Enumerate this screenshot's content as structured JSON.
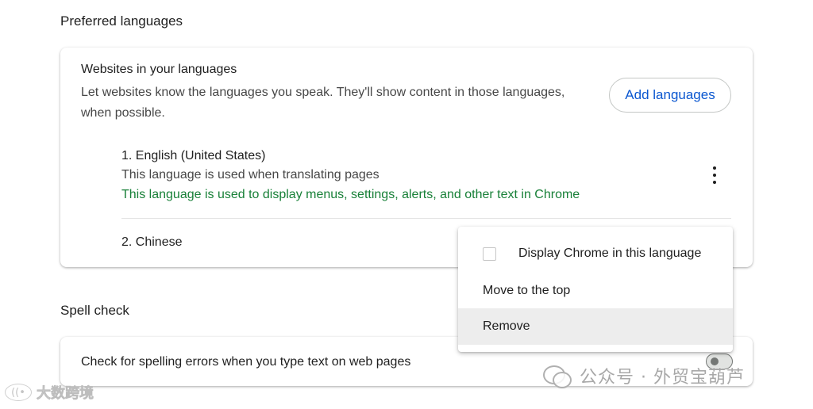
{
  "preferred_languages": {
    "section_title": "Preferred languages",
    "websites_title": "Websites in your languages",
    "websites_desc": "Let websites know the languages you speak. They'll show content in those languages, when possible.",
    "add_button_label": "Add languages",
    "languages": [
      {
        "name": "1. English (United States)",
        "note1": "This language is used when translating pages",
        "note2": "This language is used to display menus, settings, alerts, and other text in Chrome"
      },
      {
        "name": "2. Chinese"
      }
    ]
  },
  "context_menu": {
    "display_chrome_label": "Display Chrome in this language",
    "display_chrome_checked": false,
    "move_top_label": "Move to the top",
    "remove_label": "Remove"
  },
  "spell_check": {
    "section_title": "Spell check",
    "check_label": "Check for spelling errors when you type text on web pages",
    "enabled": false
  },
  "watermarks": {
    "right_text": "公众号 · 外贸宝葫芦",
    "left_logo": "((•",
    "left_text": "大数跨境"
  },
  "colors": {
    "accent": "#0b57d0",
    "green_text": "#188038",
    "hover_bg": "#ededed"
  }
}
